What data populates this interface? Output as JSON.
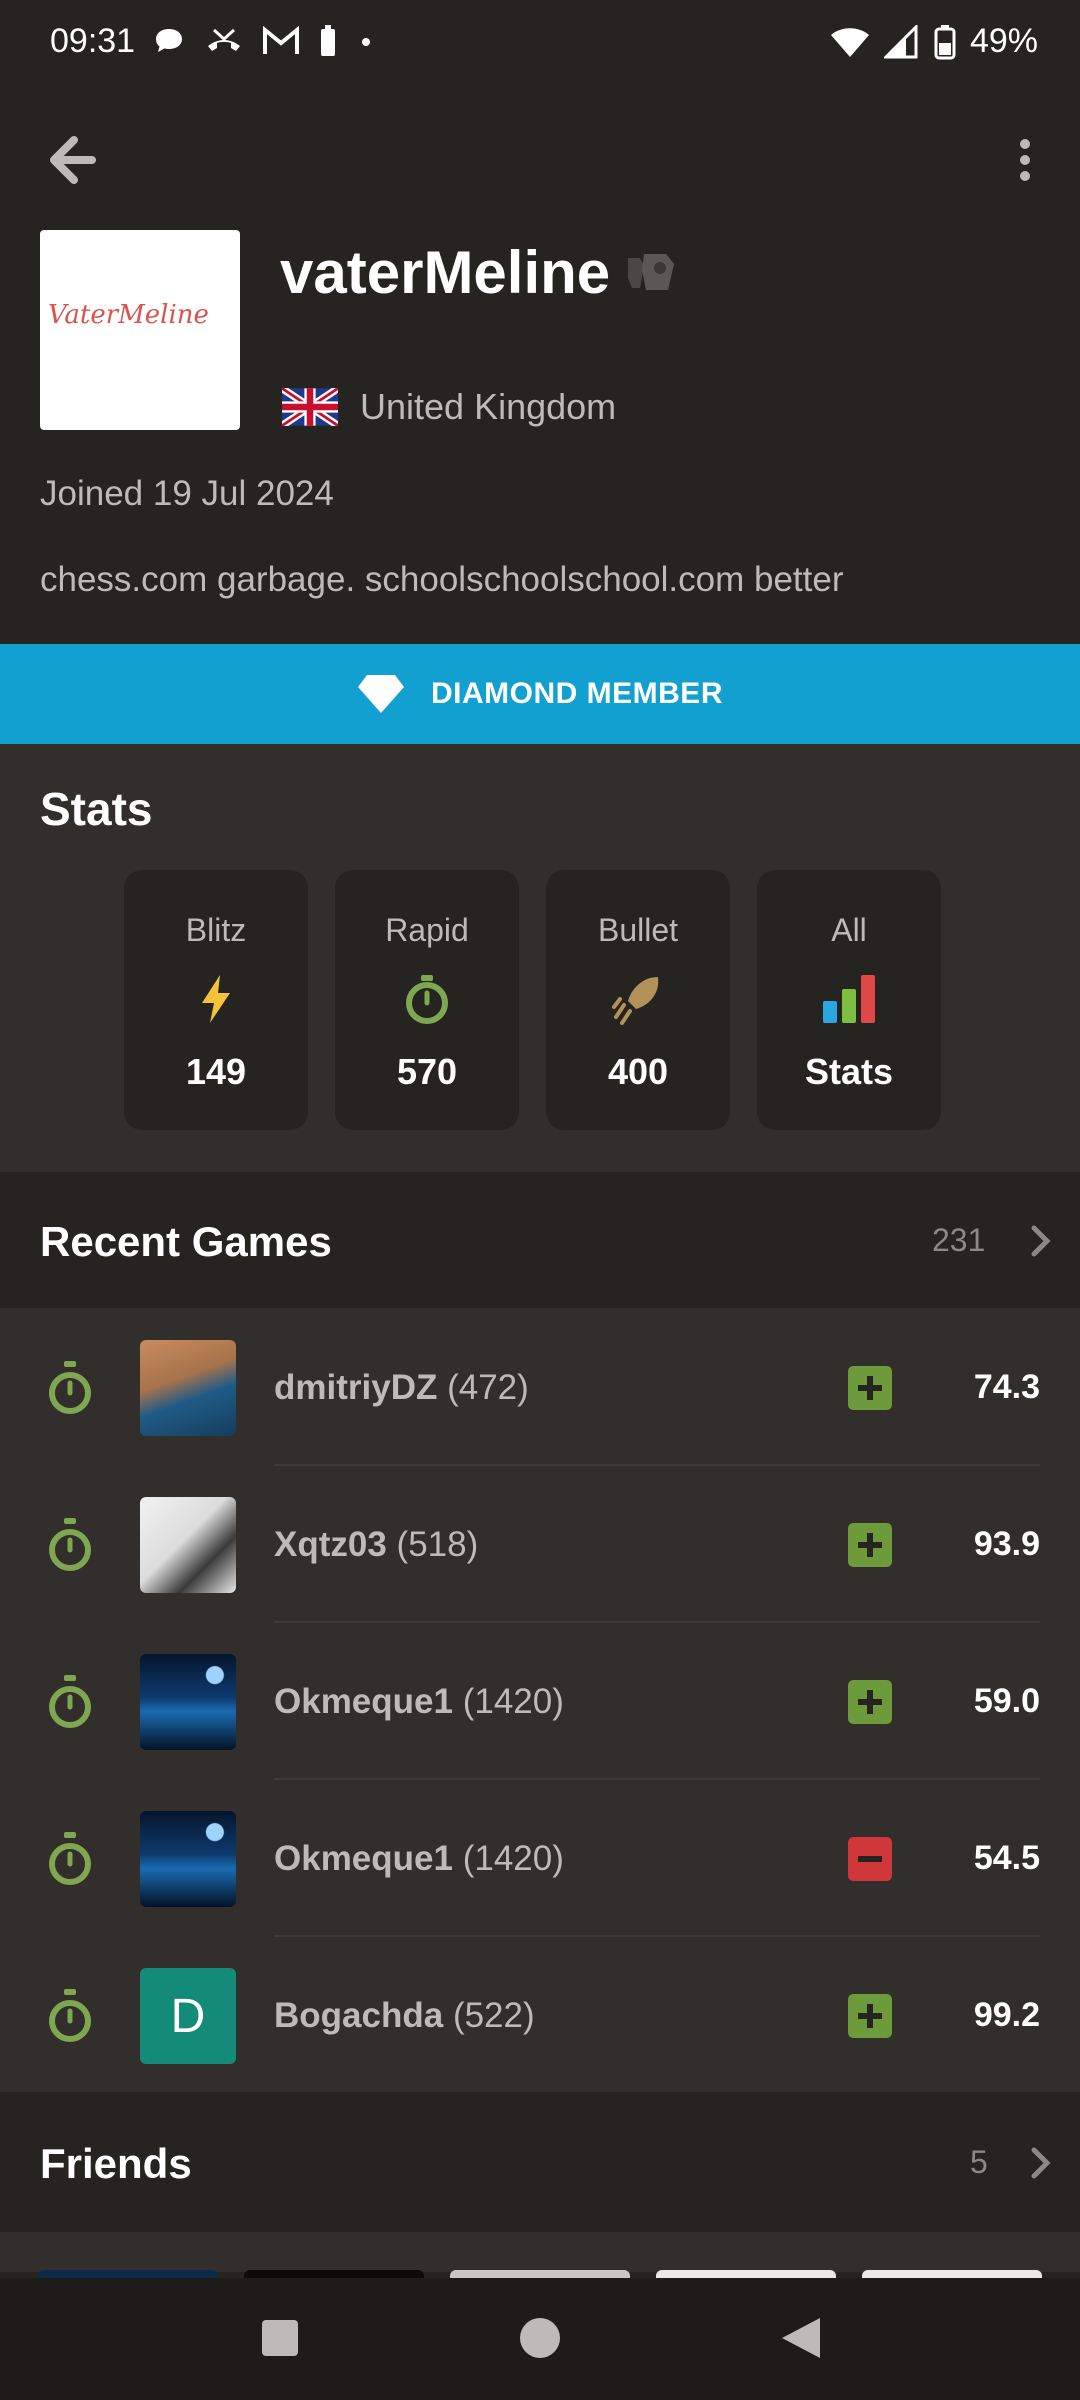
{
  "status_bar": {
    "time": "09:31",
    "battery": "49%"
  },
  "profile": {
    "username": "vaterMeline",
    "avatar_signature": "VaterMeline",
    "country": "United Kingdom",
    "joined": "Joined 19 Jul 2024",
    "bio": "chess.com garbage. schoolschoolschool.com better",
    "membership": "DIAMOND MEMBER"
  },
  "stats": {
    "title": "Stats",
    "tiles": [
      {
        "label": "Blitz",
        "value": "149",
        "icon": "lightning-icon"
      },
      {
        "label": "Rapid",
        "value": "570",
        "icon": "stopwatch-icon"
      },
      {
        "label": "Bullet",
        "value": "400",
        "icon": "bullet-icon"
      },
      {
        "label": "All",
        "value": "Stats",
        "icon": "bar-chart-icon"
      }
    ]
  },
  "recent_games": {
    "title": "Recent Games",
    "count": "231",
    "rows": [
      {
        "name": "dmitriyDZ",
        "rating": "(472)",
        "result": "win",
        "accuracy": "74.3"
      },
      {
        "name": "Xqtz03",
        "rating": "(518)",
        "result": "win",
        "accuracy": "93.9"
      },
      {
        "name": "Okmeque1",
        "rating": "(1420)",
        "result": "win",
        "accuracy": "59.0"
      },
      {
        "name": "Okmeque1",
        "rating": "(1420)",
        "result": "loss",
        "accuracy": "54.5"
      },
      {
        "name": "Bogachda",
        "rating": "(522)",
        "result": "win",
        "accuracy": "99.2",
        "avatar_letter": "D"
      }
    ]
  },
  "friends": {
    "title": "Friends",
    "count": "5"
  },
  "colors": {
    "background": "#262421",
    "panel": "#312e2b",
    "diamond_banner": "#12a0d0",
    "win": "#6d9a3b",
    "loss": "#d0373b",
    "rapid_green": "#7fa650"
  }
}
